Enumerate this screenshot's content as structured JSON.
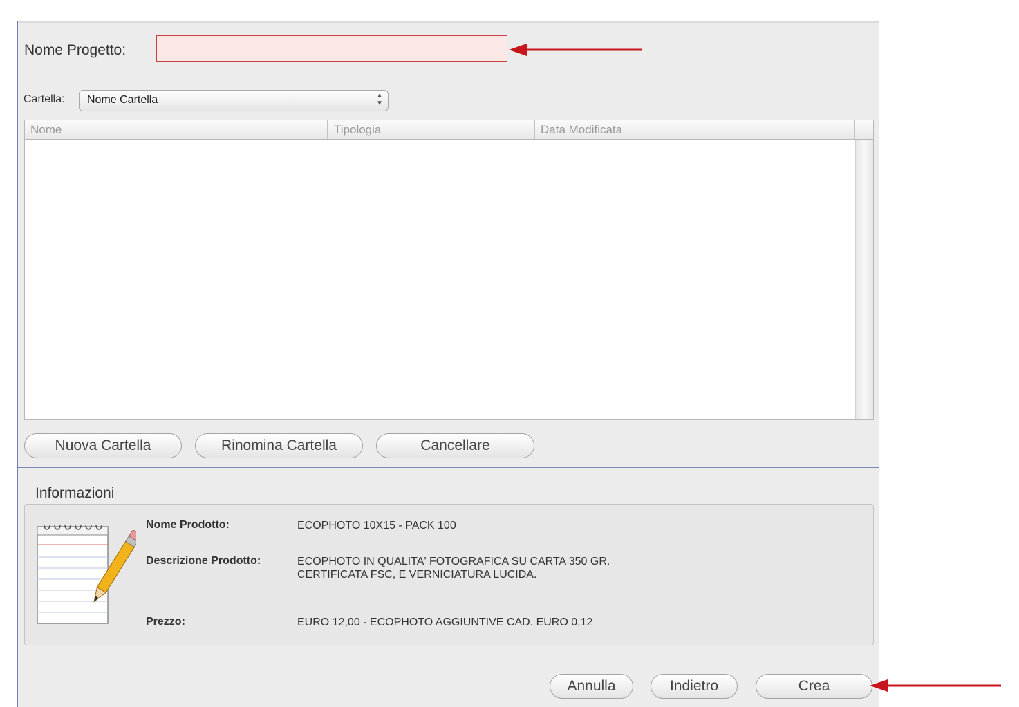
{
  "project": {
    "name_label": "Nome Progetto:",
    "name_value": ""
  },
  "folder": {
    "label": "Cartella:",
    "selected": "Nome Cartella"
  },
  "table": {
    "columns": [
      "Nome",
      "Tipologia",
      "Data Modificata"
    ],
    "rows": []
  },
  "folder_buttons": {
    "new": "Nuova Cartella",
    "rename": "Rinomina Cartella",
    "delete": "Cancellare"
  },
  "info": {
    "title": "Informazioni",
    "product_name_label": "Nome Prodotto:",
    "product_name": "ECOPHOTO 10X15 - PACK 100",
    "description_label": "Descrizione Prodotto:",
    "description_line1": "ECOPHOTO IN QUALITA' FOTOGRAFICA SU CARTA 350 GR.",
    "description_line2": "CERTIFICATA FSC, E VERNICIATURA LUCIDA.",
    "price_label": "Prezzo:",
    "price": "EURO 12,00 - ECOPHOTO AGGIUNTIVE CAD. EURO 0,12"
  },
  "actions": {
    "cancel": "Annulla",
    "back": "Indietro",
    "create": "Crea"
  },
  "colors": {
    "annotation_arrow": "#c8161e",
    "name_field_bg": "#fde8e8",
    "name_field_border": "#c84040"
  },
  "icons": {
    "notepad": "notepad-pencil-icon",
    "arrow": "red-arrow-icon"
  }
}
